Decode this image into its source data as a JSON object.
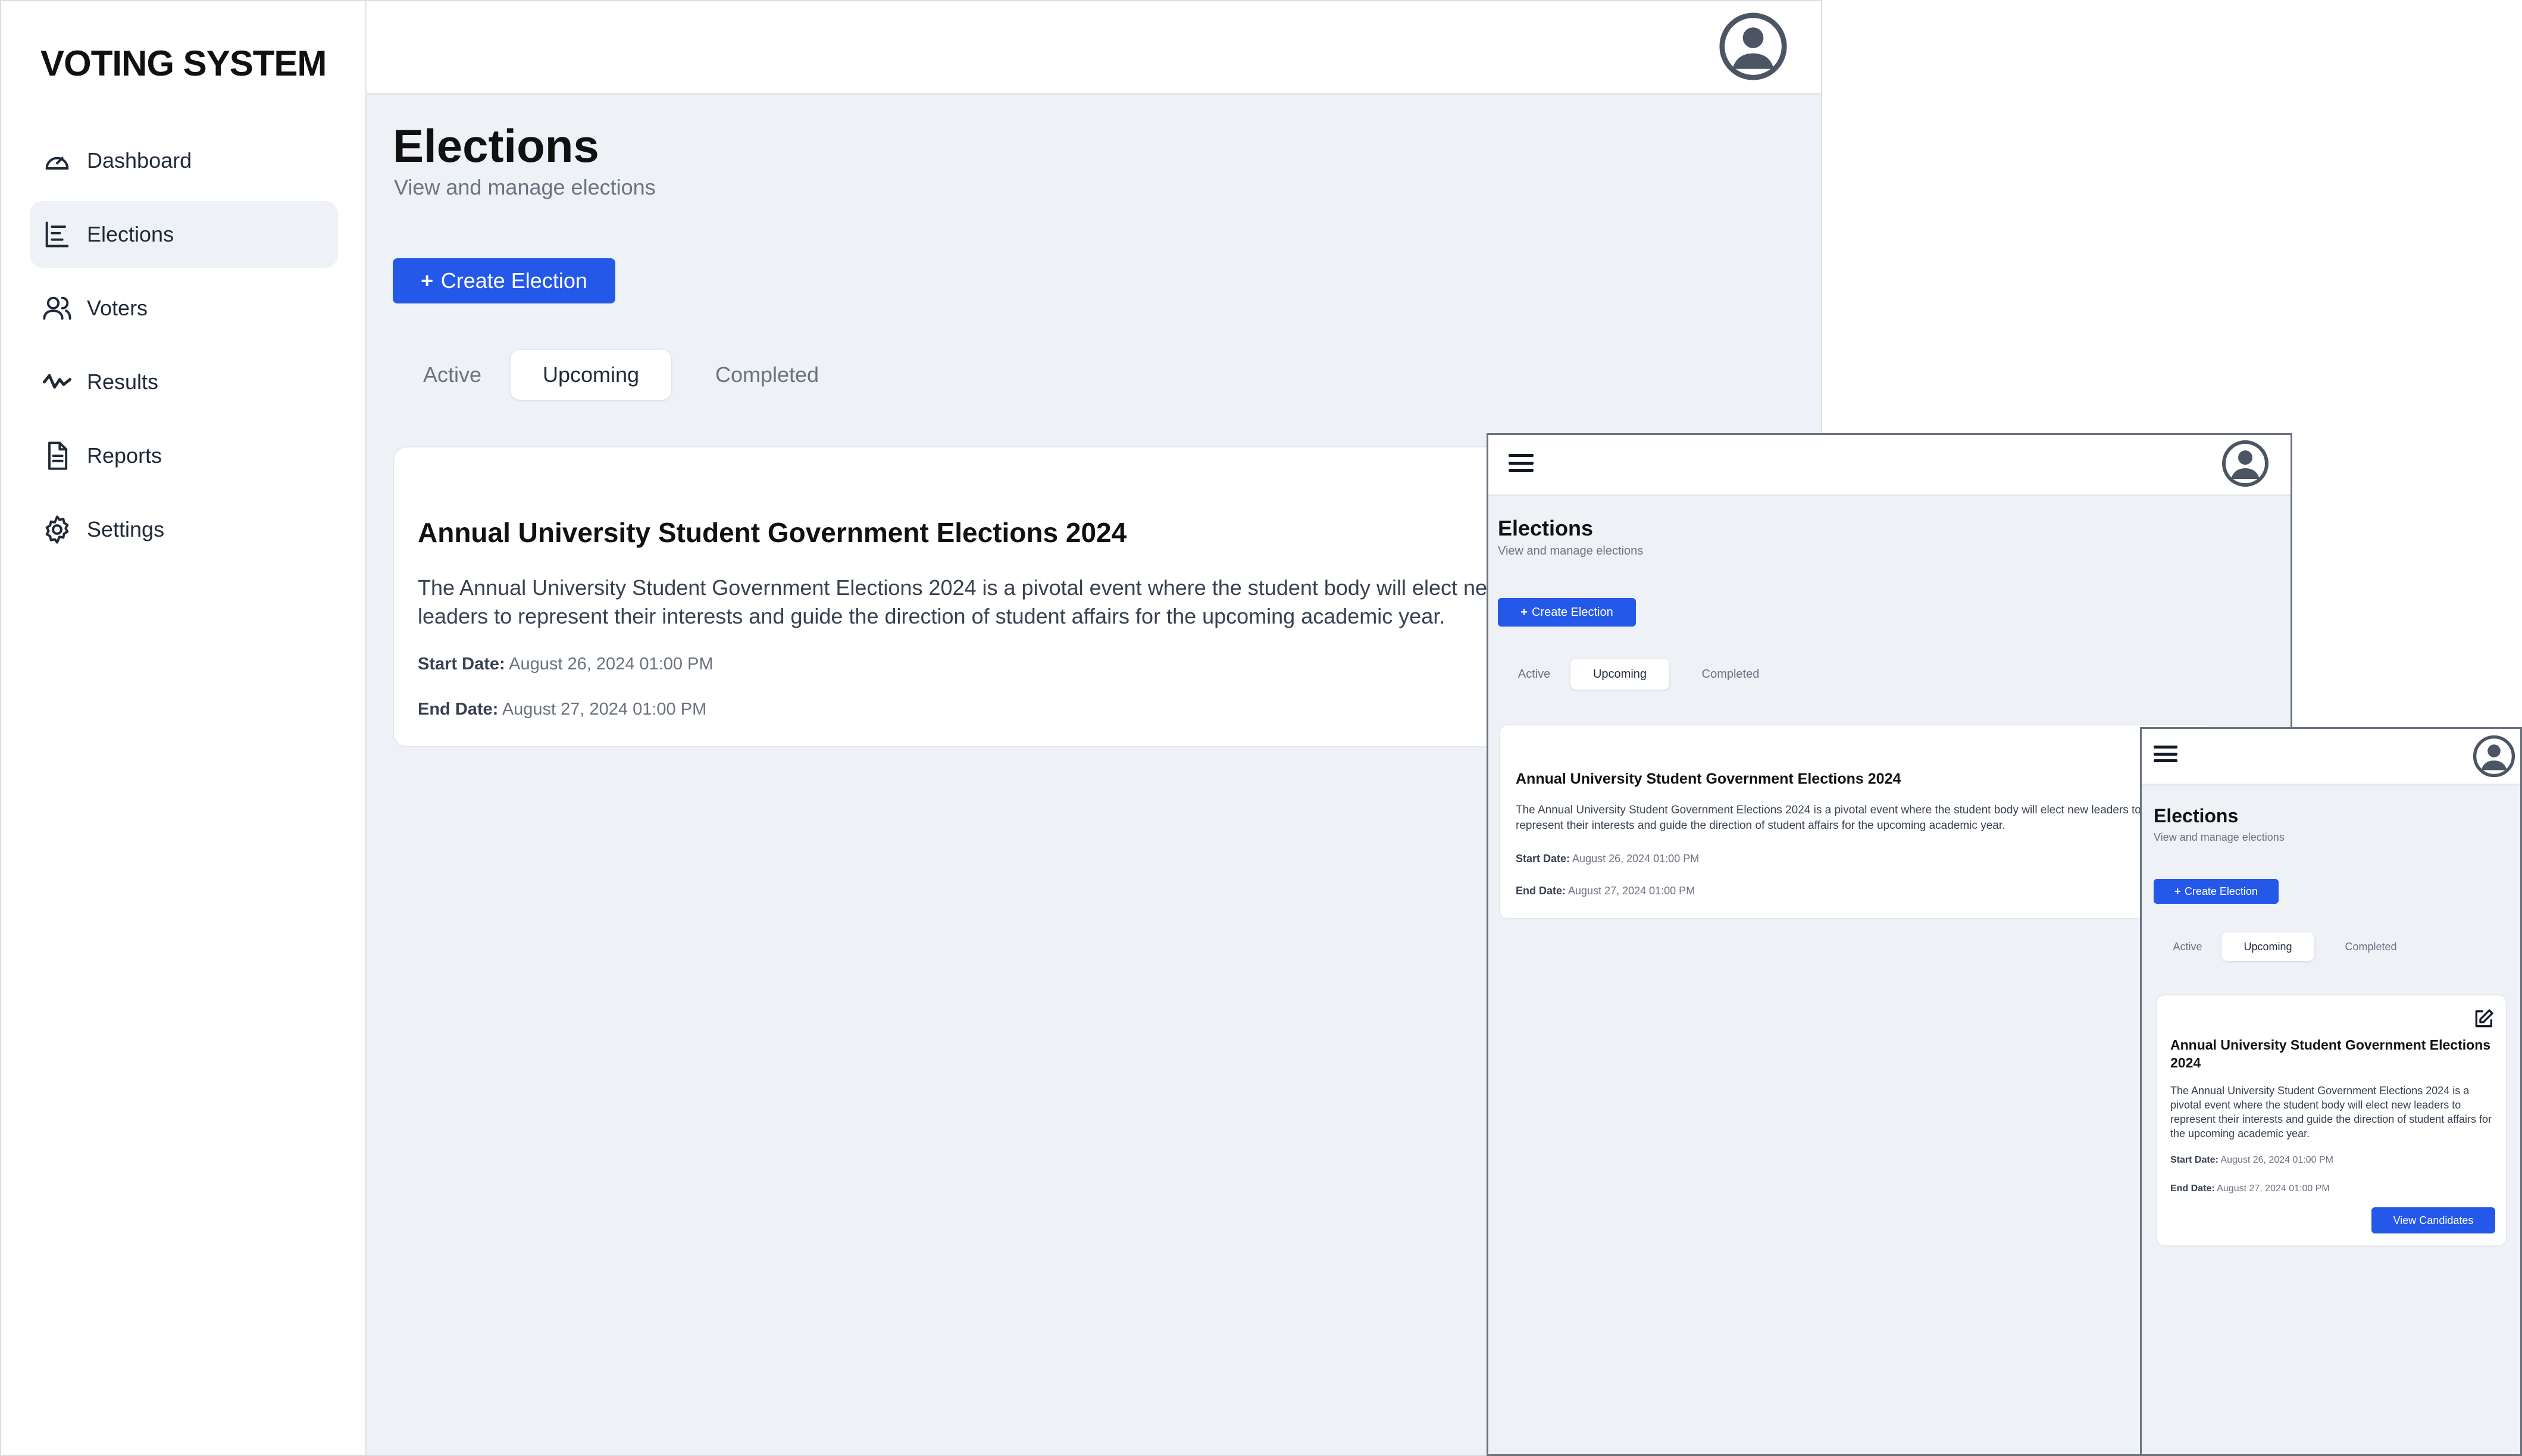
{
  "app": {
    "brand": "VOTING SYSTEM"
  },
  "sidebar": {
    "items": [
      {
        "label": "Dashboard",
        "icon": "gauge-icon"
      },
      {
        "label": "Elections",
        "icon": "bar-list-icon",
        "active": true
      },
      {
        "label": "Voters",
        "icon": "users-icon"
      },
      {
        "label": "Results",
        "icon": "trend-icon"
      },
      {
        "label": "Reports",
        "icon": "document-icon"
      },
      {
        "label": "Settings",
        "icon": "gear-icon"
      }
    ]
  },
  "header": {
    "icons": [
      "avatar-icon",
      "hamburger-menu-icon"
    ]
  },
  "page": {
    "title": "Elections",
    "subtitle": "View and manage elections",
    "create_button": "Create Election",
    "create_button_icon": "+"
  },
  "tabs": [
    {
      "label": "Active"
    },
    {
      "label": "Upcoming",
      "selected": true
    },
    {
      "label": "Completed"
    }
  ],
  "election": {
    "title": "Annual University Student Government Elections 2024",
    "description": "The Annual University Student Government Elections 2024 is a pivotal event where the student body will elect new leaders to represent their interests and guide the direction of student affairs for the upcoming academic year.",
    "start_label": "Start Date:",
    "start_value": "August 26, 2024 01:00 PM",
    "end_label": "End Date:",
    "end_value": "August 27, 2024 01:00 PM",
    "view_button": "View Candidates",
    "edit_icon": "edit-icon"
  },
  "colors": {
    "accent": "#2458e8",
    "background": "#eef1f6",
    "surface": "#ffffff"
  }
}
